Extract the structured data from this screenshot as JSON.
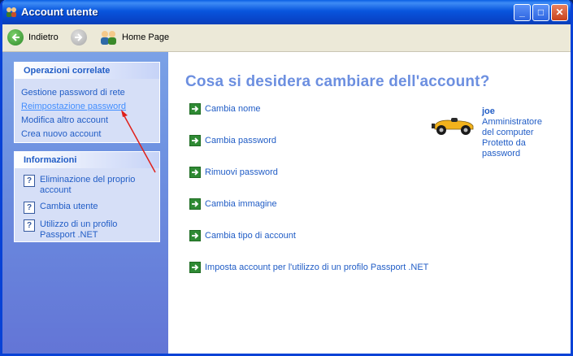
{
  "window": {
    "title": "Account utente"
  },
  "toolbar": {
    "back_label": "Indietro",
    "home_label": "Home Page"
  },
  "sidebar": {
    "related_title": "Operazioni correlate",
    "related_items": [
      {
        "label": "Gestione password di rete"
      },
      {
        "label": "Reimpostazione password"
      },
      {
        "label": "Modifica altro account"
      },
      {
        "label": "Crea nuovo account"
      }
    ],
    "info_title": "Informazioni",
    "info_items": [
      {
        "label": "Eliminazione del proprio account"
      },
      {
        "label": "Cambia utente"
      },
      {
        "label": "Utilizzo di un profilo Passport .NET"
      }
    ]
  },
  "main": {
    "heading": "Cosa si desidera cambiare dell'account?",
    "actions": [
      {
        "label": "Cambia nome"
      },
      {
        "label": "Cambia password"
      },
      {
        "label": "Rimuovi password"
      },
      {
        "label": "Cambia immagine"
      },
      {
        "label": "Cambia tipo di account"
      },
      {
        "label": "Imposta account per l'utilizzo di un profilo Passport .NET"
      }
    ],
    "user": {
      "name": "joe",
      "line1": "Amministratore",
      "line2": "del computer",
      "line3": "Protetto da",
      "line4": "password"
    }
  },
  "colors": {
    "link": "#215DC6",
    "heading": "#6C8FE0",
    "titlebar": "#0855DD"
  },
  "icons": [
    "users-icon",
    "back-arrow-icon",
    "forward-arrow-icon",
    "home-users-icon",
    "minimize-icon",
    "maximize-icon",
    "close-icon",
    "help-icon",
    "green-arrow-icon",
    "race-car-avatar-icon"
  ]
}
